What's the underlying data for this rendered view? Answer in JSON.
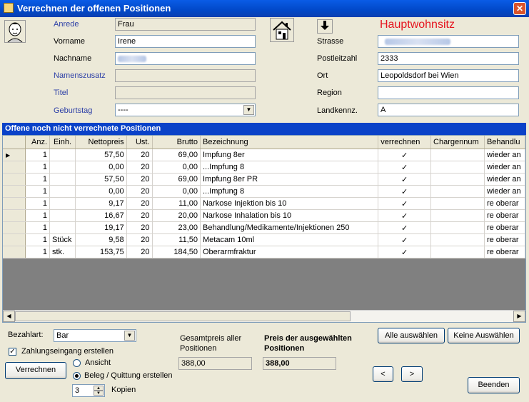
{
  "window": {
    "title": "Verrechnen der offenen Positionen",
    "close_glyph": "✕"
  },
  "person": {
    "anrede_label": "Anrede",
    "anrede_value": "Frau",
    "vorname_label": "Vorname",
    "vorname_value": "Irene",
    "nachname_label": "Nachname",
    "nachname_value": "",
    "namenszusatz_label": "Namenszusatz",
    "namenszusatz_value": "",
    "titel_label": "Titel",
    "titel_value": "",
    "geburtstag_label": "Geburtstag",
    "geburtstag_value": "----"
  },
  "address": {
    "heading": "Hauptwohnsitz",
    "strasse_label": "Strasse",
    "strasse_value": "",
    "plz_label": "Postleitzahl",
    "plz_value": "2333",
    "ort_label": "Ort",
    "ort_value": "Leopoldsdorf bei Wien",
    "region_label": "Region",
    "region_value": "",
    "land_label": "Landkennz.",
    "land_value": "A"
  },
  "grid": {
    "title": "Offene noch nicht verrechnete Positionen",
    "columns": [
      "Anz.",
      "Einh.",
      "Nettopreis",
      "Ust.",
      "Brutto",
      "Bezeichnung",
      "verrechnen",
      "Chargennum",
      "Behandlu"
    ],
    "rows": [
      [
        "1",
        "",
        "57,50",
        "20",
        "69,00",
        "Impfung 8er",
        "✓",
        "",
        "wieder an"
      ],
      [
        "1",
        "",
        "0,00",
        "20",
        "0,00",
        "...Impfung 8",
        "✓",
        "",
        "wieder an"
      ],
      [
        "1",
        "",
        "57,50",
        "20",
        "69,00",
        "Impfung 8er PR",
        "✓",
        "",
        "wieder an"
      ],
      [
        "1",
        "",
        "0,00",
        "20",
        "0,00",
        "...Impfung 8",
        "✓",
        "",
        "wieder an"
      ],
      [
        "1",
        "",
        "9,17",
        "20",
        "11,00",
        "Narkose Injektion bis 10",
        "✓",
        "",
        "re oberar"
      ],
      [
        "1",
        "",
        "16,67",
        "20",
        "20,00",
        "Narkose Inhalation bis 10",
        "✓",
        "",
        "re oberar"
      ],
      [
        "1",
        "",
        "19,17",
        "20",
        "23,00",
        "Behandlung/Medikamente/Injektionen 250",
        "✓",
        "",
        "re oberar"
      ],
      [
        "1",
        "Stück",
        "9,58",
        "20",
        "11,50",
        "Metacam 10ml",
        "✓",
        "",
        "re oberar"
      ],
      [
        "1",
        "stk.",
        "153,75",
        "20",
        "184,50",
        "Oberarmfraktur",
        "✓",
        "",
        "re oberar"
      ]
    ],
    "row_marker": "▶"
  },
  "footer": {
    "bezahlart_label": "Bezahlart:",
    "bezahlart_value": "Bar",
    "zahlungseingang_label": "Zahlungseingang erstellen",
    "verrechnen_button": "Verrechnen",
    "ansicht_label": "Ansicht",
    "beleg_label": "Beleg / Quittung erstellen",
    "kopien_value": "3",
    "kopien_label": "Kopien",
    "gesamtpreis_label": "Gesamtpreis aller Positionen",
    "gesamtpreis_value": "388,00",
    "auswahl_label": "Preis der ausgewählten Positionen",
    "auswahl_value": "388,00",
    "alle_button": "Alle auswählen",
    "keine_button": "Keine Auswählen",
    "prev_button": "<",
    "next_button": ">",
    "beenden_button": "Beenden"
  }
}
